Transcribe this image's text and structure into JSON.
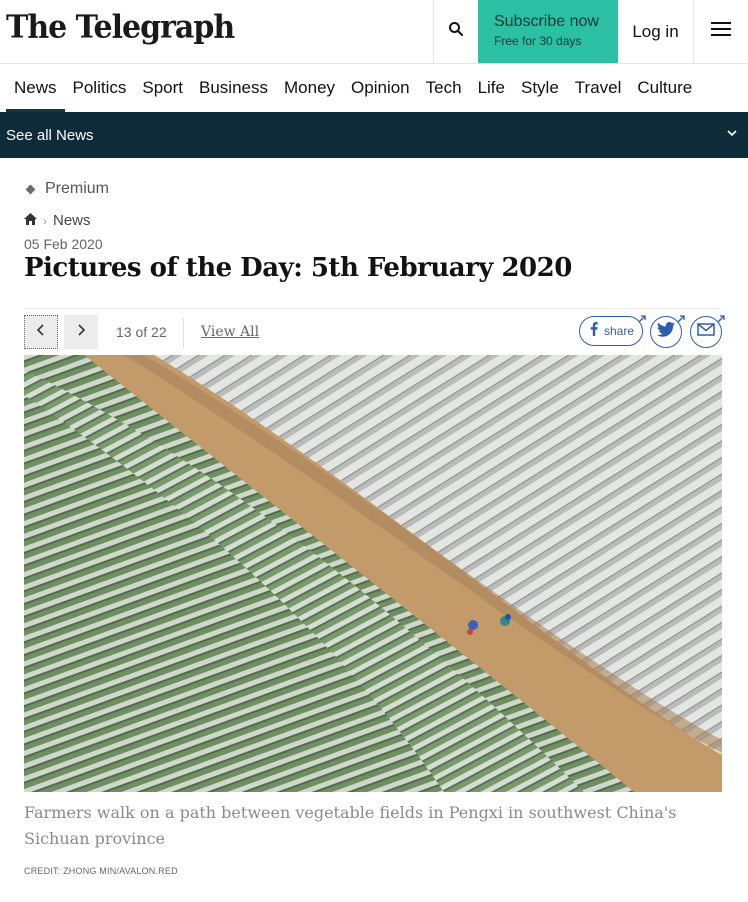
{
  "header": {
    "logo": "The Telegraph",
    "subscribe_label": "Subscribe now",
    "subscribe_sub": "Free for 30 days",
    "login_label": "Log in",
    "search_icon": "search-icon",
    "menu_icon": "hamburger-menu-icon"
  },
  "nav": {
    "items": [
      "News",
      "Politics",
      "Sport",
      "Business",
      "Money",
      "Opinion",
      "Tech",
      "Life",
      "Style",
      "Travel",
      "Culture"
    ],
    "active": "News"
  },
  "section_bar": {
    "label": "See all News"
  },
  "article": {
    "badge": "Premium",
    "breadcrumb": "News",
    "date": "05 Feb 2020",
    "title": "Pictures of the Day: 5th February 2020"
  },
  "gallery": {
    "counter": "13 of 22",
    "view_all": "View All",
    "share_label": "share",
    "caption": "Farmers walk on a path between vegetable fields in Pengxi in southwest China's Sichuan province",
    "credit": "CREDIT: ZHONG MIN/AVALON.RED"
  },
  "colors": {
    "brand_teal": "#2bbfa3",
    "section_bar": "#0d2b38",
    "share_blue": "#2f5ea8"
  }
}
